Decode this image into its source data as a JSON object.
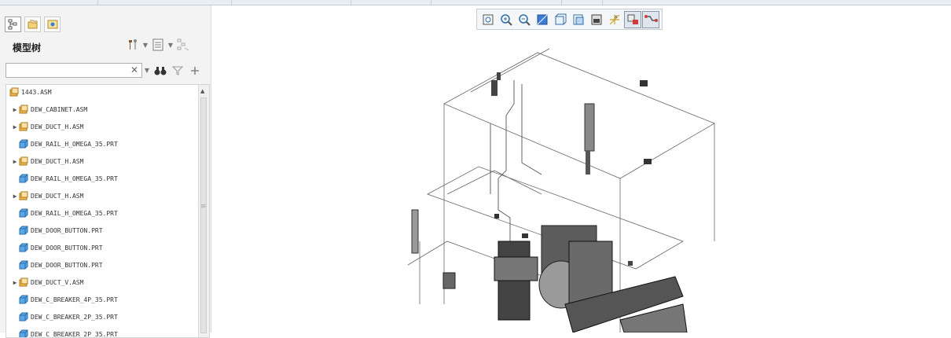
{
  "model_tree": {
    "title": "模型树",
    "search": {
      "value": "",
      "placeholder": ""
    },
    "items": [
      {
        "name": "1443.ASM",
        "kind": "asm",
        "indent": 0,
        "expandable": false
      },
      {
        "name": "DEW_CABINET.ASM",
        "kind": "asm",
        "indent": 1,
        "expandable": true
      },
      {
        "name": "DEW_DUCT_H.ASM",
        "kind": "asm",
        "indent": 1,
        "expandable": true
      },
      {
        "name": "DEW_RAIL_H_OMEGA_35.PRT",
        "kind": "prt",
        "indent": 1,
        "expandable": false
      },
      {
        "name": "DEW_DUCT_H.ASM",
        "kind": "asm",
        "indent": 1,
        "expandable": true
      },
      {
        "name": "DEW_RAIL_H_OMEGA_35.PRT",
        "kind": "prt",
        "indent": 1,
        "expandable": false
      },
      {
        "name": "DEW_DUCT_H.ASM",
        "kind": "asm",
        "indent": 1,
        "expandable": true
      },
      {
        "name": "DEW_RAIL_H_OMEGA_35.PRT",
        "kind": "prt",
        "indent": 1,
        "expandable": false
      },
      {
        "name": "DEW_DOOR_BUTTON.PRT",
        "kind": "prt",
        "indent": 1,
        "expandable": false
      },
      {
        "name": "DEW_DOOR_BUTTON.PRT",
        "kind": "prt",
        "indent": 1,
        "expandable": false
      },
      {
        "name": "DEW_DOOR_BUTTON.PRT",
        "kind": "prt",
        "indent": 1,
        "expandable": false
      },
      {
        "name": "DEW_DUCT_V.ASM",
        "kind": "asm",
        "indent": 1,
        "expandable": true
      },
      {
        "name": "DEW_C_BREAKER_4P_35.PRT",
        "kind": "prt",
        "indent": 1,
        "expandable": false
      },
      {
        "name": "DEW_C_BREAKER_2P_35.PRT",
        "kind": "prt",
        "indent": 1,
        "expandable": false
      },
      {
        "name": "DEW_C_BREAKER_2P_35.PRT",
        "kind": "prt",
        "indent": 1,
        "expandable": false
      }
    ]
  },
  "graphics_toolbar": [
    {
      "icon": "refit-icon",
      "active": false
    },
    {
      "icon": "zoom-in-icon",
      "active": false
    },
    {
      "icon": "zoom-out-icon",
      "active": false
    },
    {
      "icon": "repaint-icon",
      "active": false
    },
    {
      "icon": "display-style-icon",
      "active": false
    },
    {
      "icon": "saved-orientations-icon",
      "active": false
    },
    {
      "icon": "view-manager-icon",
      "active": false
    },
    {
      "icon": "datum-display-icon",
      "active": false
    },
    {
      "icon": "spin-center-icon",
      "active": true
    },
    {
      "icon": "annotation-display-icon",
      "active": true
    }
  ],
  "colors": {
    "accent": "#3a7bd5",
    "asm_icon": "#f2b84b",
    "prt_icon": "#56a9e8",
    "model_line": "#555555"
  }
}
